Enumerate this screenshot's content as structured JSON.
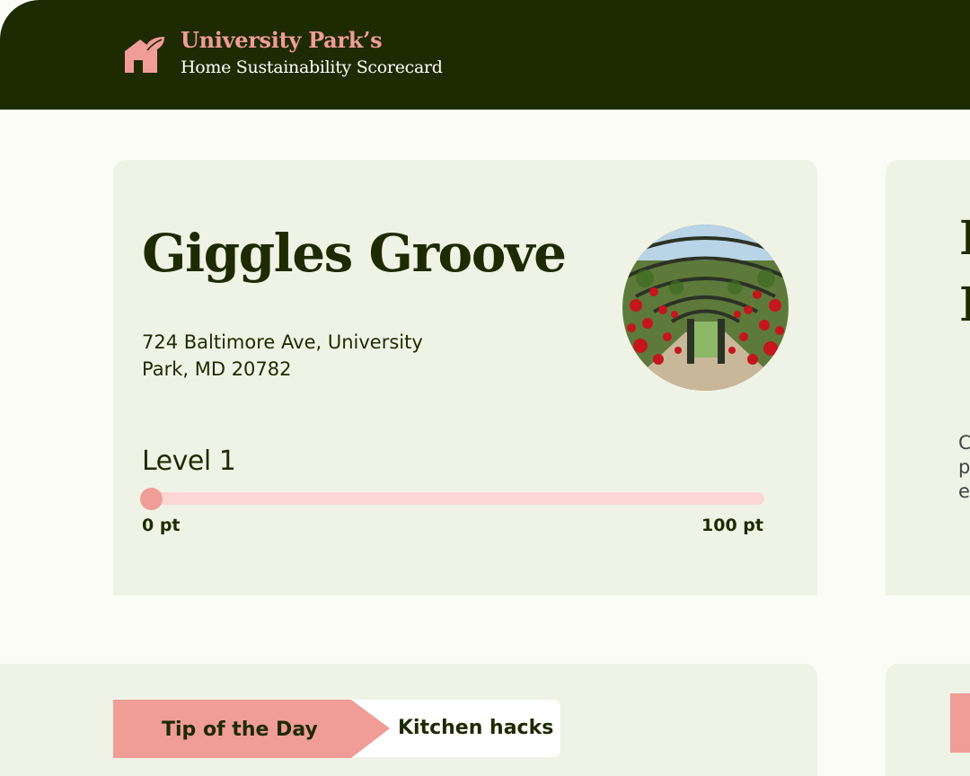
{
  "header": {
    "brand_title": "University Park’s",
    "brand_subtitle": "Home Sustainability Scorecard",
    "logo_icon": "house-leaf-icon"
  },
  "home": {
    "name": "Giggles Groove",
    "address": "724 Baltimore Ave, University Park, MD 20782",
    "photo_icon": "garden-arch-photo",
    "level": "Level 1",
    "progress": {
      "value_fraction": 0,
      "min_label": "0 pt",
      "max_label": "100 pt"
    }
  },
  "tip": {
    "label": "Tip of the Day",
    "topic": "Kitchen hacks"
  },
  "colors": {
    "header_bg": "#1e2a00",
    "accent_pink": "#ef9d96",
    "track_pink": "#fbd6d5",
    "card_bg": "#eff3e5",
    "page_bg": "#fbfcf6"
  }
}
